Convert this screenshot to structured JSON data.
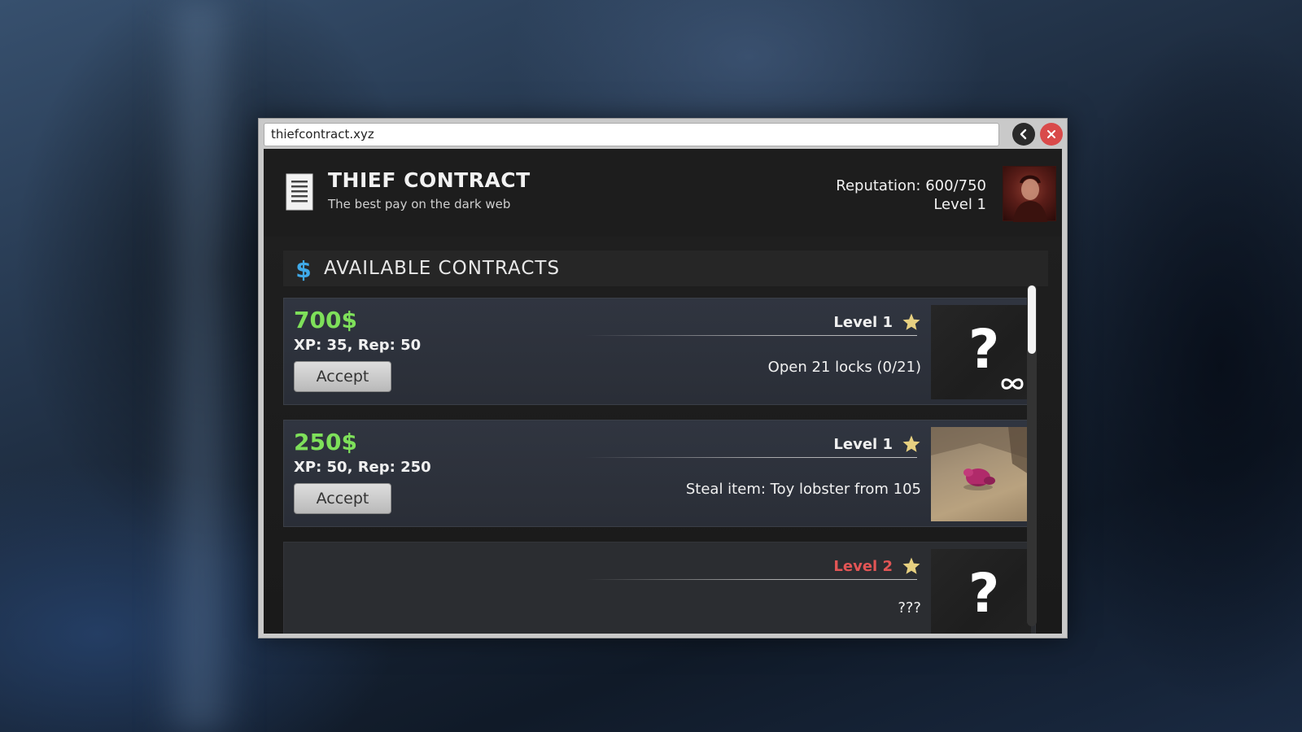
{
  "browser": {
    "url": "thiefcontract.xyz"
  },
  "header": {
    "title": "THIEF CONTRACT",
    "subtitle": "The best pay on the dark web",
    "reputation": "Reputation: 600/750",
    "level": "Level 1"
  },
  "section": {
    "title": "AVAILABLE CONTRACTS"
  },
  "contracts": [
    {
      "price": "700$",
      "rewards": "XP: 35, Rep: 50",
      "accept_label": "Accept",
      "level": "Level 1",
      "task": "Open 21 locks (0/21)",
      "thumbnail": "question-mark-icon",
      "repeatable": true
    },
    {
      "price": "250$",
      "rewards": "XP: 50, Rep: 250",
      "accept_label": "Accept",
      "level": "Level 1",
      "task": "Steal item: Toy lobster from 105",
      "thumbnail": "toy-lobster-photo"
    },
    {
      "level": "Level 2",
      "task": "???",
      "thumbnail": "question-mark-icon",
      "locked": true
    }
  ],
  "colors": {
    "price": "#7ee05a",
    "locked_level": "#e25555",
    "star": "#e7d080",
    "close_button": "#d94a4a"
  }
}
